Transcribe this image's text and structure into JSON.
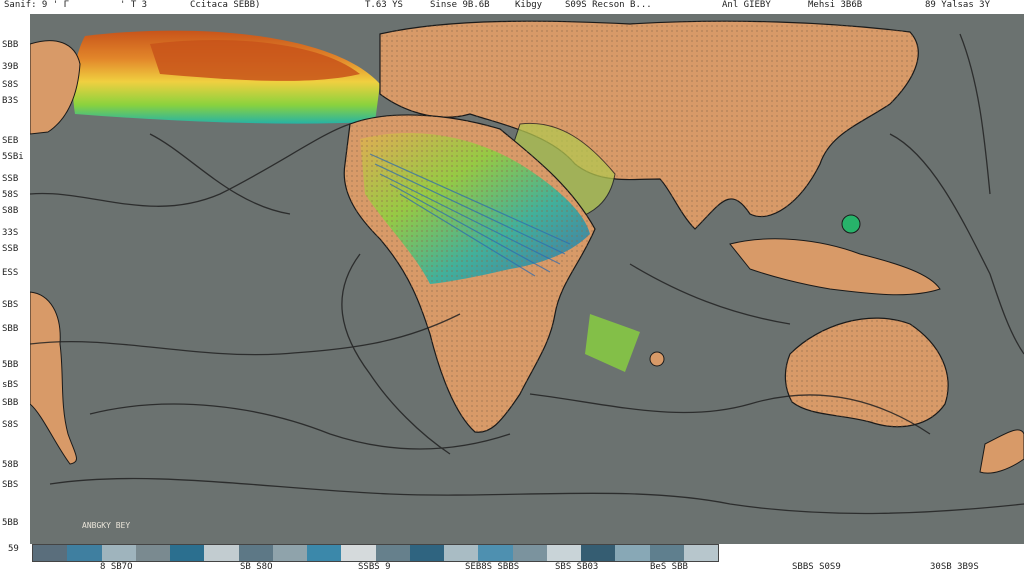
{
  "top_axis_labels": [
    "Sanif: 9 ' Γ",
    "' T 3",
    "Ccitaca SEBB)",
    "T.63 YS",
    "Sinse 9B.6B",
    "Kibgy",
    "S09S Recson B...",
    "Anl GIEBY",
    "Mehsi 3B6B",
    "89 Yalsas 3Y"
  ],
  "left_axis_labels": [
    "SBB",
    "39B",
    "S8S",
    "B3S",
    "SEB",
    "5SBi",
    "SSB",
    "58S",
    "S8B",
    "33S",
    "SSB",
    "ESS",
    "SBS",
    "SBB",
    "5BB",
    "sBS",
    "SBB",
    "S8S",
    "58B",
    "SBS",
    "5BB"
  ],
  "map": {
    "ocean_color": "#6b7270",
    "land_color": "#d89a68",
    "border_color": "#1a1a1a",
    "heat_colors": [
      "#c8541a",
      "#e2862a",
      "#f0d040",
      "#8ad23e",
      "#27b3a4",
      "#2a6ab2"
    ]
  },
  "scale_label": "ANBGKY BEY",
  "colorbar": {
    "label": "59",
    "colors": [
      "#5a6e7c",
      "#3f7fa0",
      "#9fb4bd",
      "#7a8a90",
      "#2b6f8f",
      "#c2ccd0",
      "#5d7886",
      "#8fa3ab",
      "#3b88aa",
      "#d5dadc",
      "#66808c",
      "#2f6480",
      "#a9bcc4",
      "#4e90b0",
      "#7b939e",
      "#c9d4d8",
      "#355d72",
      "#88a8b6",
      "#5f7f8e",
      "#b7c6cc"
    ]
  },
  "bottom_axis_labels": [
    "8 SB7O",
    "SB S8O",
    "SSBS 9",
    "SEB8S SBBS",
    "SBS SB03",
    "BeS SBB",
    "SBBS S0S9",
    "30SB 3B9S"
  ]
}
